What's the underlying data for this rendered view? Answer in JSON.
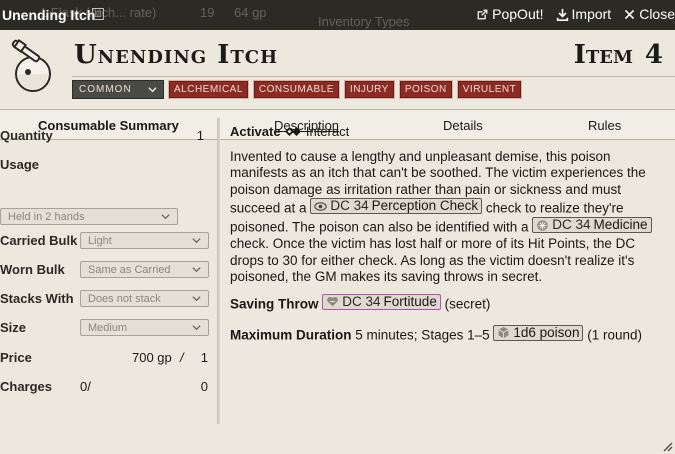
{
  "window": {
    "title": "Unending Itch",
    "popout_label": "PopOut!",
    "import_label": "Import",
    "close_label": "Close",
    "background_text": {
      "left": "1 Flask (Alch... rate)",
      "price_count": "19",
      "price_value": "64 gp",
      "panel_title": "Inventory Types"
    }
  },
  "item": {
    "name": "Unending Itch",
    "type_label": "Item",
    "level": "4",
    "rarity": "COMMON",
    "traits": [
      "ALCHEMICAL",
      "CONSUMABLE",
      "INJURY",
      "POISON",
      "VIRULENT"
    ]
  },
  "tabs": {
    "summary": "Consumable Summary",
    "description": "Description",
    "details": "Details",
    "rules": "Rules"
  },
  "sidebar": {
    "quantity_label": "Quantity",
    "quantity_value": "1",
    "usage_label": "Usage",
    "usage_value": "Held in 2 hands",
    "carried_bulk_label": "Carried Bulk",
    "carried_bulk_value": "Light",
    "worn_bulk_label": "Worn Bulk",
    "worn_bulk_value": "Same as Carried",
    "stacks_with_label": "Stacks With",
    "stacks_with_value": "Does not stack",
    "size_label": "Size",
    "size_value": "Medium",
    "price_label": "Price",
    "price_value": "700 gp",
    "price_slash": "/",
    "price_per": "1",
    "charges_label": "Charges",
    "charges_value": "0/",
    "charges_max": "0"
  },
  "description": {
    "activate_label": "Activate",
    "activate_value": "Interact",
    "p1": "Invented to cause a lengthy and unpleasant demise, this poison manifests as an itch that can't be soothed. The victim experiences the poison damage as irritation rather than pain or sickness and must succeed at a",
    "check1_dc": "DC 34",
    "check1_skill": "Perception Check",
    "p2": "check to realize they're poisoned. The poison can also be identified with a",
    "check2_dc": "DC 34",
    "check2_skill": "Medicine",
    "p3": "check. Once the victim has lost half or more of its Hit Points, the DC drops to 30 for either check. As long as the victim doesn't realize it's poisoned, the GM makes its saving throws in secret.",
    "saving_throw_label": "Saving Throw",
    "save_dc": "DC 34",
    "save_skill": "Fortitude",
    "save_note": "(secret)",
    "max_duration_label": "Maximum Duration",
    "max_duration_value": "5 minutes; Stages 1–5",
    "damage_roll": "1d6 poison",
    "damage_note": "(1 round)"
  }
}
